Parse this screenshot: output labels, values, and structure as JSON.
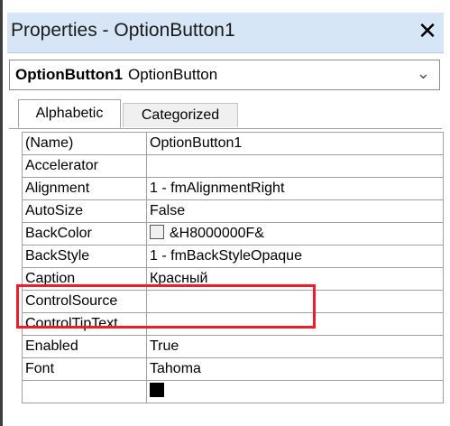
{
  "window": {
    "title": "Properties - OptionButton1",
    "close_glyph": "✕"
  },
  "object_selector": {
    "name": "OptionButton1",
    "type": "OptionButton",
    "arrow_glyph": "⌄"
  },
  "tabs": [
    {
      "label": "Alphabetic",
      "active": true
    },
    {
      "label": "Categorized",
      "active": false
    }
  ],
  "properties": [
    {
      "name": "(Name)",
      "value": "OptionButton1"
    },
    {
      "name": "Accelerator",
      "value": ""
    },
    {
      "name": "Alignment",
      "value": "1 - fmAlignmentRight"
    },
    {
      "name": "AutoSize",
      "value": "False"
    },
    {
      "name": "BackColor",
      "value": "&H8000000F&"
    },
    {
      "name": "BackStyle",
      "value": "1 - fmBackStyleOpaque"
    },
    {
      "name": "Caption",
      "value": "Красный"
    },
    {
      "name": "ControlSource",
      "value": ""
    },
    {
      "name": "ControlTipText",
      "value": ""
    },
    {
      "name": "Enabled",
      "value": "True"
    },
    {
      "name": "Font",
      "value": "Tahoma"
    },
    {
      "name": "",
      "value": ""
    }
  ],
  "colors": {
    "titlebar": "#d7e6f7",
    "highlight": "#e8202a",
    "grid_lines": "#a0a0a0"
  }
}
